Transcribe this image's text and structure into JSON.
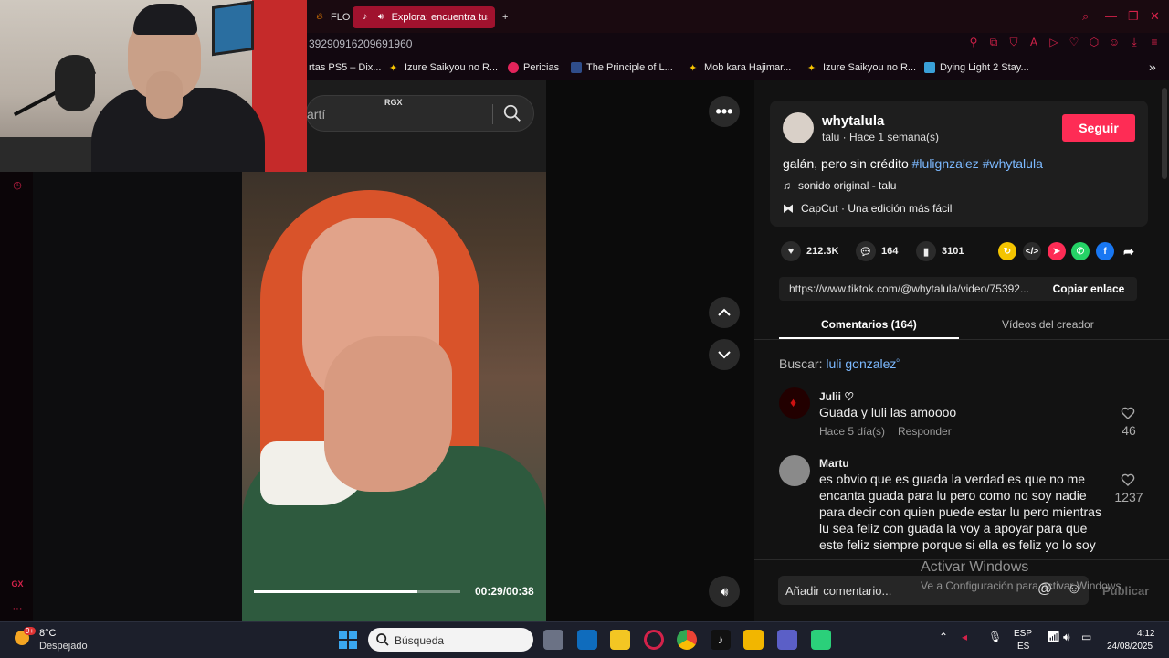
{
  "browser": {
    "tabs": [
      {
        "label": "FLO",
        "icon": "fire-icon"
      },
      {
        "label": "Explora: encuentra tus",
        "icon": "tiktok-icon",
        "active": true
      }
    ],
    "new_tab": "+",
    "url": "39290916209691960",
    "bookmarks": [
      {
        "label": "rtas PS5 – Dix..."
      },
      {
        "label": "Izure Saikyou no R..."
      },
      {
        "label": "Pericias"
      },
      {
        "label": "The Principle of L..."
      },
      {
        "label": "Mob kara Hajimar..."
      },
      {
        "label": "Izure Saikyou no R..."
      },
      {
        "label": "Dying Light 2 Stay..."
      }
    ],
    "more_bookmarks": "»"
  },
  "sidebar": {
    "gx_label": "GX",
    "more_label": "···"
  },
  "video": {
    "search_query": "artí",
    "watermark": "RGX",
    "time": "00:29/00:38",
    "progress": 0.79
  },
  "post": {
    "username": "whytalula",
    "subline": "talu · Hace 1 semana(s)",
    "follow_label": "Seguir",
    "caption_text": "galán, pero sin crédito ",
    "hashtags": [
      "#lulignzalez",
      "#whytalula"
    ],
    "music": "sonido original - talu",
    "capcut": "CapCut · Una edición más fácil",
    "likes": "212.3K",
    "comments_count": "164",
    "saves": "3101",
    "link": "https://www.tiktok.com/@whytalula/video/75392...",
    "copy_label": "Copiar enlace"
  },
  "panel_tabs": {
    "comments": "Comentarios (164)",
    "creator_videos": "Vídeos del creador"
  },
  "search": {
    "prefix": "Buscar:",
    "term": "luli gonzalez"
  },
  "comments": [
    {
      "name": "Julii",
      "badge": "♡",
      "text": "Guada y luli las amoooo",
      "time": "Hace 5 día(s)",
      "reply": "Responder",
      "likes": "46"
    },
    {
      "name": "Martu",
      "text_lines": [
        "es obvio que es guada la verdad es que no me",
        "encanta guada para lu pero como no soy nadie",
        "para decir con quien puede estar lu pero mientras",
        "lu sea feliz con guada la voy a apoyar para que",
        "este feliz siempre porque si ella es feliz yo lo soy"
      ],
      "likes": "1237"
    }
  ],
  "comment_input": {
    "placeholder": "Añadir comentario...",
    "publish": "Publicar"
  },
  "windows_watermark": {
    "line1": "Activar Windows",
    "line2": "Ve a Configuración para activar Windows."
  },
  "taskbar": {
    "weather_temp": "8°C",
    "weather_desc": "Despejado",
    "weather_badge": "9+",
    "search_label": "Búsqueda",
    "lang_top": "ESP",
    "lang_bottom": "ES",
    "time": "4:12",
    "date": "24/08/2025"
  },
  "colors": {
    "accent": "#fe2c55",
    "opera_red": "#d4224a",
    "hashtag": "#7cb9ff",
    "panel_bg": "#121212"
  }
}
